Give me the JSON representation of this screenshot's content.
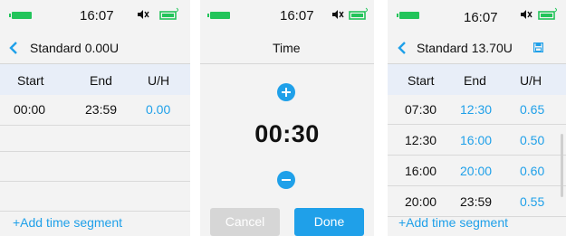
{
  "colors": {
    "accent": "#1fa0e9",
    "battery": "#22c45a",
    "header_bg": "#e8eef8",
    "cancel_bg": "#d6d6d6"
  },
  "screen1": {
    "time": "16:07",
    "title": "Standard 0.00U",
    "headers": [
      "Start",
      "End",
      "U/H"
    ],
    "rows": [
      {
        "start": "00:00",
        "end": "23:59",
        "rate": "0.00"
      }
    ],
    "add_label": "+Add time segment"
  },
  "screen2": {
    "time": "16:07",
    "title": "Time",
    "value": "00:30",
    "cancel_label": "Cancel",
    "done_label": "Done"
  },
  "screen3": {
    "time": "16:07",
    "title": "Standard 13.70U",
    "headers": [
      "Start",
      "End",
      "U/H"
    ],
    "rows": [
      {
        "start": "07:30",
        "end": "12:30",
        "rate": "0.65",
        "end_color": "blue"
      },
      {
        "start": "12:30",
        "end": "16:00",
        "rate": "0.50",
        "end_color": "blue"
      },
      {
        "start": "16:00",
        "end": "20:00",
        "rate": "0.60",
        "end_color": "blue"
      },
      {
        "start": "20:00",
        "end": "23:59",
        "rate": "0.55",
        "end_color": "black"
      }
    ],
    "add_label": "+Add time segment"
  },
  "icons": [
    "battery-icon",
    "speaker-mute-icon",
    "bluetooth-battery-icon",
    "back-chevron-icon",
    "plus-icon",
    "minus-icon",
    "save-icon"
  ]
}
